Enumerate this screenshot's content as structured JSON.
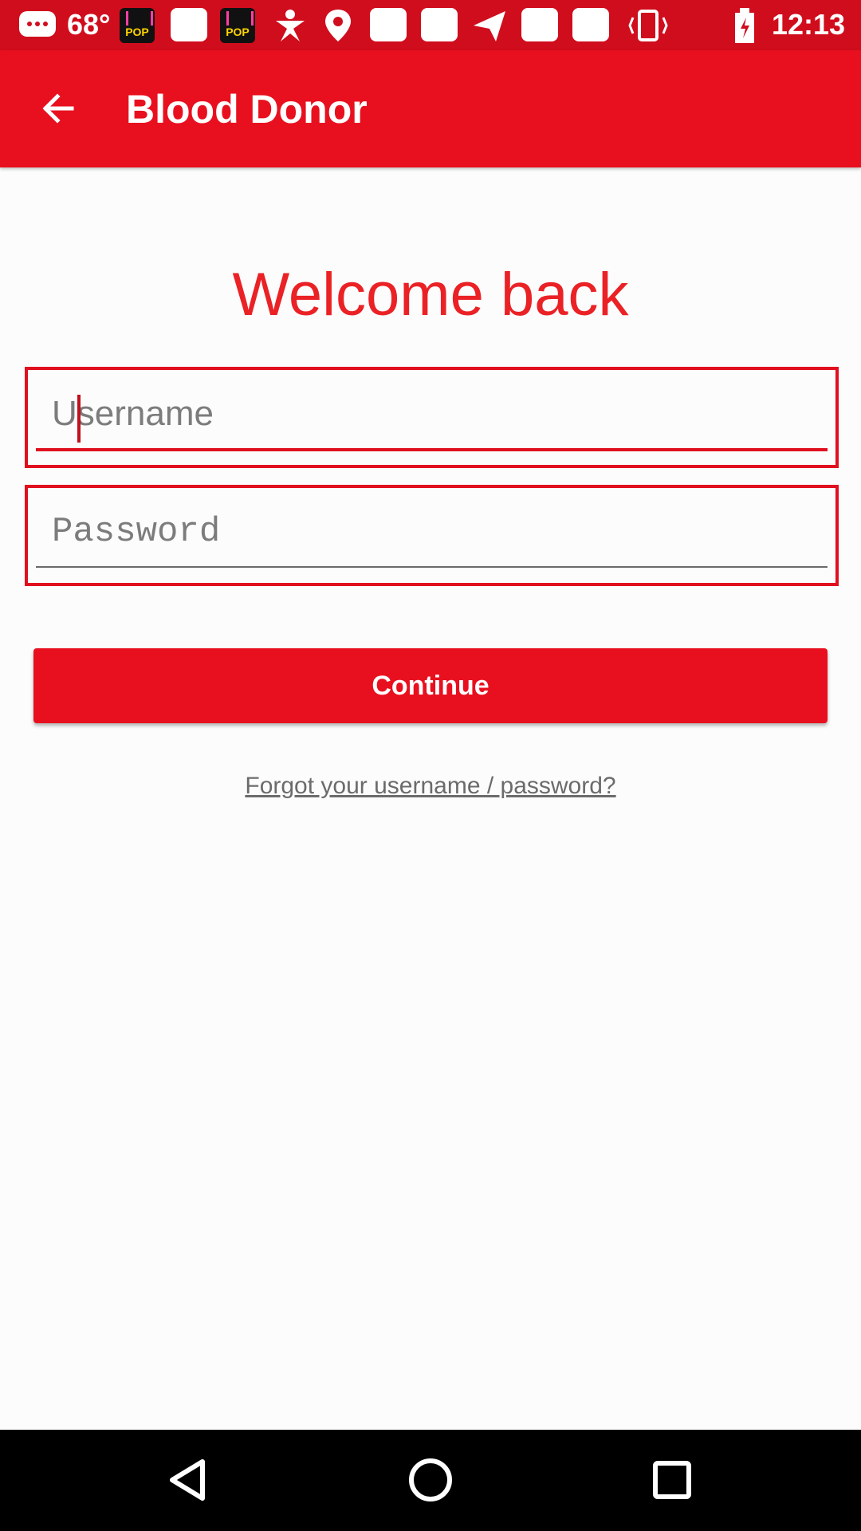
{
  "status_bar": {
    "temperature": "68°",
    "time": "12:13",
    "icons": [
      "message-icon",
      "pop-app-icon",
      "notification-icon",
      "pop-app-icon",
      "figure-icon",
      "location-icon",
      "notification-icon",
      "notification-icon",
      "send-icon",
      "notification-icon",
      "notification-icon",
      "vibrate-icon",
      "battery-icon"
    ]
  },
  "app_bar": {
    "title": "Blood Donor",
    "back_icon": "arrow-back-icon"
  },
  "form": {
    "heading": "Welcome back",
    "username_placeholder": "Username",
    "password_placeholder": "Password",
    "continue_label": "Continue",
    "forgot_label": "Forgot your username / password?"
  },
  "colors": {
    "accent": "#e8101f",
    "heading": "#ea2226",
    "status_bar": "#d00d1d"
  },
  "nav_bar": {
    "icons": [
      "back-triangle-icon",
      "home-circle-icon",
      "recents-square-icon"
    ]
  }
}
